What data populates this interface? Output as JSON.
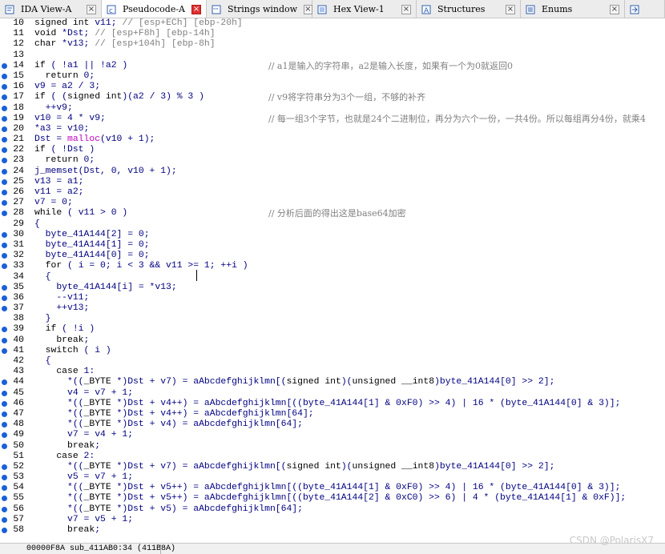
{
  "tabs": [
    {
      "label": "IDA View-A",
      "icon": "ida-view-icon",
      "active": false
    },
    {
      "label": "Pseudocode-A",
      "icon": "pseudocode-icon",
      "active": true
    },
    {
      "label": "Strings window",
      "icon": "strings-icon",
      "active": false
    },
    {
      "label": "Hex View-1",
      "icon": "hex-view-icon",
      "active": false
    },
    {
      "label": "Structures",
      "icon": "structures-icon",
      "active": false
    },
    {
      "label": "Enums",
      "icon": "enums-icon",
      "active": false
    },
    {
      "label": "",
      "icon": "imports-icon",
      "active": false
    }
  ],
  "colors": {
    "keyword": "#000080",
    "comment": "#808080",
    "var": "#000080",
    "breakpoint": "#1a60d8",
    "active_close": "#e03030"
  },
  "code_lines": [
    {
      "n": "10",
      "bp": false,
      "text": "signed int v11; // [esp+ECh] [ebp-20h]",
      "comment": ""
    },
    {
      "n": "11",
      "bp": false,
      "text": "void *Dst; // [esp+F8h] [ebp-14h]",
      "comment": ""
    },
    {
      "n": "12",
      "bp": false,
      "text": "char *v13; // [esp+104h] [ebp-8h]",
      "comment": ""
    },
    {
      "n": "13",
      "bp": false,
      "text": "",
      "comment": ""
    },
    {
      "n": "14",
      "bp": true,
      "text": "if ( !a1 || !a2 )",
      "comment": "// a1是输入的字符串，a2是输入长度，如果有一个为0就返回0"
    },
    {
      "n": "15",
      "bp": true,
      "text": "  return 0;",
      "comment": ""
    },
    {
      "n": "16",
      "bp": true,
      "text": "v9 = a2 / 3;",
      "comment": ""
    },
    {
      "n": "17",
      "bp": true,
      "text": "if ( (signed int)(a2 / 3) % 3 )",
      "comment": "// v9将字符串分为3个一组，不够的补齐"
    },
    {
      "n": "18",
      "bp": true,
      "text": "  ++v9;",
      "comment": ""
    },
    {
      "n": "19",
      "bp": true,
      "text": "v10 = 4 * v9;",
      "comment": "// 每一组3个字节，也就是24个二进制位，再分为六个一份，一共4份。所以每组再分4份，就乘4"
    },
    {
      "n": "20",
      "bp": true,
      "text": "*a3 = v10;",
      "comment": ""
    },
    {
      "n": "21",
      "bp": true,
      "text": "Dst = malloc(v10 + 1);",
      "comment": ""
    },
    {
      "n": "22",
      "bp": true,
      "text": "if ( !Dst )",
      "comment": ""
    },
    {
      "n": "23",
      "bp": true,
      "text": "  return 0;",
      "comment": ""
    },
    {
      "n": "24",
      "bp": true,
      "text": "j_memset(Dst, 0, v10 + 1);",
      "comment": ""
    },
    {
      "n": "25",
      "bp": true,
      "text": "v13 = a1;",
      "comment": ""
    },
    {
      "n": "26",
      "bp": true,
      "text": "v11 = a2;",
      "comment": ""
    },
    {
      "n": "27",
      "bp": true,
      "text": "v7 = 0;",
      "comment": ""
    },
    {
      "n": "28",
      "bp": true,
      "text": "while ( v11 > 0 )",
      "comment": "// 分析后面的得出这是base64加密"
    },
    {
      "n": "29",
      "bp": false,
      "text": "{",
      "comment": ""
    },
    {
      "n": "30",
      "bp": true,
      "text": "  byte_41A144[2] = 0;",
      "comment": ""
    },
    {
      "n": "31",
      "bp": true,
      "text": "  byte_41A144[1] = 0;",
      "comment": ""
    },
    {
      "n": "32",
      "bp": true,
      "text": "  byte_41A144[0] = 0;",
      "comment": ""
    },
    {
      "n": "33",
      "bp": true,
      "text": "  for ( i = 0; i < 3 && v11 >= 1; ++i )",
      "comment": ""
    },
    {
      "n": "34",
      "bp": false,
      "text": "  {",
      "comment": ""
    },
    {
      "n": "35",
      "bp": true,
      "text": "    byte_41A144[i] = *v13;",
      "comment": ""
    },
    {
      "n": "36",
      "bp": true,
      "text": "    --v11;",
      "comment": ""
    },
    {
      "n": "37",
      "bp": true,
      "text": "    ++v13;",
      "comment": ""
    },
    {
      "n": "38",
      "bp": false,
      "text": "  }",
      "comment": ""
    },
    {
      "n": "39",
      "bp": true,
      "text": "  if ( !i )",
      "comment": ""
    },
    {
      "n": "40",
      "bp": true,
      "text": "    break;",
      "comment": ""
    },
    {
      "n": "41",
      "bp": true,
      "text": "  switch ( i )",
      "comment": ""
    },
    {
      "n": "42",
      "bp": false,
      "text": "  {",
      "comment": ""
    },
    {
      "n": "43",
      "bp": false,
      "text": "    case 1:",
      "comment": ""
    },
    {
      "n": "44",
      "bp": true,
      "text": "      *((_BYTE *)Dst + v7) = aAbcdefghijklmn[(signed int)(unsigned __int8)byte_41A144[0] >> 2];",
      "comment": ""
    },
    {
      "n": "45",
      "bp": true,
      "text": "      v4 = v7 + 1;",
      "comment": ""
    },
    {
      "n": "46",
      "bp": true,
      "text": "      *((_BYTE *)Dst + v4++) = aAbcdefghijklmn[((byte_41A144[1] & 0xF0) >> 4) | 16 * (byte_41A144[0] & 3)];",
      "comment": ""
    },
    {
      "n": "47",
      "bp": true,
      "text": "      *((_BYTE *)Dst + v4++) = aAbcdefghijklmn[64];",
      "comment": ""
    },
    {
      "n": "48",
      "bp": true,
      "text": "      *((_BYTE *)Dst + v4) = aAbcdefghijklmn[64];",
      "comment": ""
    },
    {
      "n": "49",
      "bp": true,
      "text": "      v7 = v4 + 1;",
      "comment": ""
    },
    {
      "n": "50",
      "bp": true,
      "text": "      break;",
      "comment": ""
    },
    {
      "n": "51",
      "bp": false,
      "text": "    case 2:",
      "comment": ""
    },
    {
      "n": "52",
      "bp": true,
      "text": "      *((_BYTE *)Dst + v7) = aAbcdefghijklmn[(signed int)(unsigned __int8)byte_41A144[0] >> 2];",
      "comment": ""
    },
    {
      "n": "53",
      "bp": true,
      "text": "      v5 = v7 + 1;",
      "comment": ""
    },
    {
      "n": "54",
      "bp": true,
      "text": "      *((_BYTE *)Dst + v5++) = aAbcdefghijklmn[((byte_41A144[1] & 0xF0) >> 4) | 16 * (byte_41A144[0] & 3)];",
      "comment": ""
    },
    {
      "n": "55",
      "bp": true,
      "text": "      *((_BYTE *)Dst + v5++) = aAbcdefghijklmn[((byte_41A144[2] & 0xC0) >> 6) | 4 * (byte_41A144[1] & 0xF)];",
      "comment": ""
    },
    {
      "n": "56",
      "bp": true,
      "text": "      *((_BYTE *)Dst + v5) = aAbcdefghijklmn[64];",
      "comment": ""
    },
    {
      "n": "57",
      "bp": true,
      "text": "      v7 = v5 + 1;",
      "comment": ""
    },
    {
      "n": "58",
      "bp": true,
      "text": "      break;",
      "comment": ""
    }
  ],
  "status": {
    "text": "00000F8A sub_411AB0:34 (411B8A)"
  },
  "watermark": "CSDN @PolarisX7"
}
